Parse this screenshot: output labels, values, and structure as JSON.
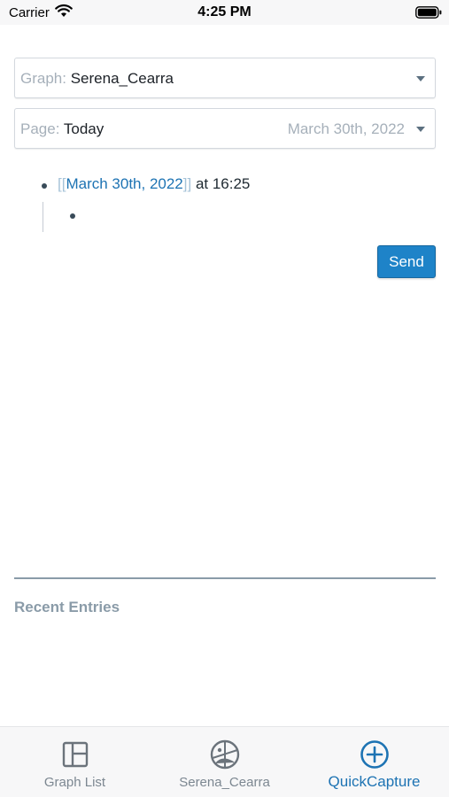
{
  "status_bar": {
    "carrier": "Carrier",
    "time": "4:25 PM"
  },
  "graph_selector": {
    "label": "Graph:",
    "value": "Serena_Cearra"
  },
  "page_selector": {
    "label": "Page:",
    "value": "Today",
    "date": "March 30th, 2022"
  },
  "capture": {
    "open_bracket": "[[",
    "link_text": "March 30th, 2022",
    "close_bracket": "]]",
    "suffix": " at 16:25"
  },
  "send_label": "Send",
  "recent": {
    "title": "Recent Entries"
  },
  "tabs": [
    {
      "label": "Graph List",
      "icon": "graph-list-icon"
    },
    {
      "label": "Serena_Cearra",
      "icon": "graph-avatar-icon"
    },
    {
      "label": "QuickCapture",
      "icon": "plus-circle-icon",
      "active": true
    }
  ],
  "colors": {
    "accent": "#1d73b3",
    "send_button": "#1e83c8",
    "muted": "#a6b0ba"
  }
}
